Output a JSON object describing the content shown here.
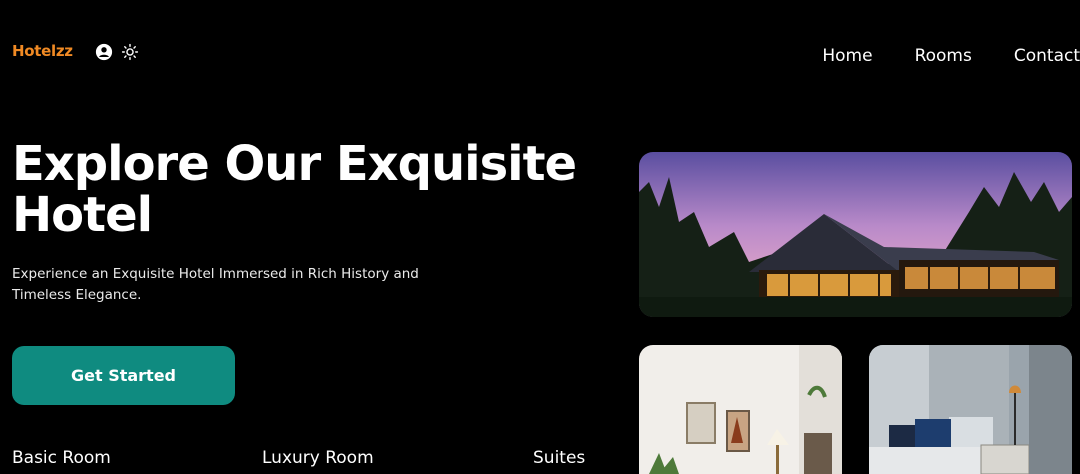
{
  "header": {
    "logo": "Hotelzz",
    "icons": [
      "user-circle-icon",
      "sun-icon"
    ]
  },
  "nav": {
    "items": [
      "Home",
      "Rooms",
      "Contact"
    ]
  },
  "hero": {
    "title": "Explore Our Exquisite Hotel",
    "subtitle": "Experience an Exquisite Hotel Immersed in Rich History and Timeless Elegance.",
    "cta_label": "Get Started"
  },
  "room_types": [
    "Basic Room",
    "Luxury Room",
    "Suites"
  ],
  "colors": {
    "background": "#000000",
    "brand": "#f08a24",
    "button": "#0f8b80",
    "text": "#ffffff"
  }
}
